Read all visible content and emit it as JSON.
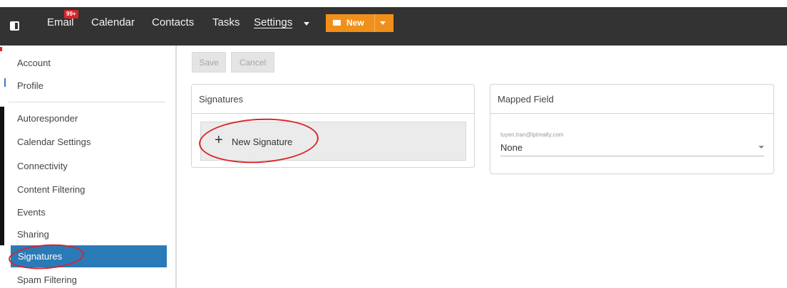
{
  "topnav": {
    "items": [
      "Email",
      "Calendar",
      "Contacts",
      "Tasks",
      "Settings"
    ],
    "email_badge": "99+",
    "new_button_label": "New",
    "accent_color": "#f0901a",
    "bar_color": "#333333"
  },
  "sidebar": {
    "group1": [
      "Account",
      "Profile"
    ],
    "group2": [
      "Autoresponder",
      "Calendar Settings",
      "Connectivity",
      "Content Filtering",
      "Events",
      "Sharing",
      "Signatures",
      "Spam Filtering"
    ],
    "active": "Signatures",
    "active_color": "#2a7ab8"
  },
  "toolbar": {
    "save_label": "Save",
    "cancel_label": "Cancel"
  },
  "signatures_card": {
    "title": "Signatures",
    "new_signature_label": "New Signature"
  },
  "mapped_field_card": {
    "title": "Mapped Field",
    "field_label": "tuyen.tran@lptrealty.com",
    "selected_value": "None"
  },
  "icons": {
    "panel_toggle": "panel-toggle-icon",
    "envelope": "envelope-icon",
    "plus": "plus-icon",
    "caret": "chevron-down-icon"
  }
}
